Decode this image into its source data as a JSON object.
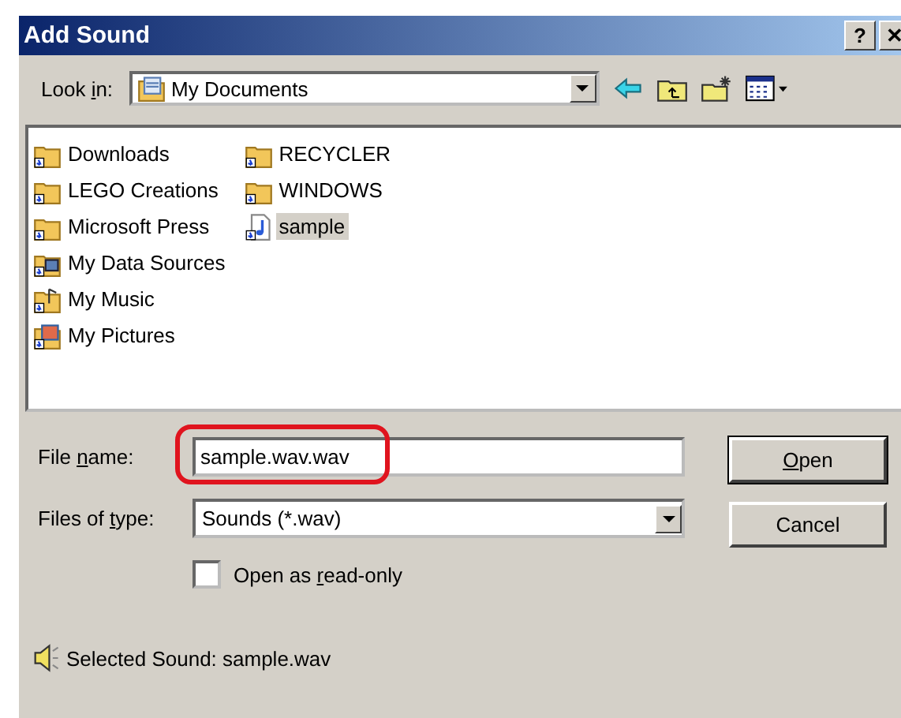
{
  "window": {
    "title": "Add Sound",
    "buttons": [
      {
        "label": "?"
      },
      {
        "label": "✕"
      }
    ]
  },
  "look_in": {
    "label": {
      "before": "Look ",
      "key": "i",
      "after": "n:"
    },
    "value": "My Documents"
  },
  "files": [
    {
      "name": "Downloads",
      "kind": "folder",
      "selected": false
    },
    {
      "name": "LEGO Creations",
      "kind": "folder",
      "selected": false
    },
    {
      "name": "Microsoft Press",
      "kind": "folder",
      "selected": false
    },
    {
      "name": "My Data Sources",
      "kind": "data-folder",
      "selected": false
    },
    {
      "name": "My Music",
      "kind": "music-folder",
      "selected": false
    },
    {
      "name": "My Pictures",
      "kind": "pictures-folder",
      "selected": false
    },
    {
      "name": "RECYCLER",
      "kind": "folder",
      "selected": false
    },
    {
      "name": "WINDOWS",
      "kind": "folder",
      "selected": false
    },
    {
      "name": "sample",
      "kind": "sound",
      "selected": true
    }
  ],
  "file_name": {
    "label": {
      "before": "File ",
      "key": "n",
      "after": "ame:"
    },
    "value": "sample.wav.wav",
    "highlight": true
  },
  "files_of_type": {
    "label": {
      "before": "Files of ",
      "key": "t",
      "after": "ype:"
    },
    "value": "Sounds (*.wav)"
  },
  "read_only": {
    "label": {
      "before": "Open as ",
      "key": "r",
      "after": "ead-only"
    },
    "checked": false
  },
  "buttons": [
    {
      "label": {
        "key": "O",
        "after": "pen"
      },
      "default": true
    },
    {
      "label": {
        "before": "Cancel"
      },
      "default": false
    }
  ],
  "status": "Selected Sound: sample.wav"
}
